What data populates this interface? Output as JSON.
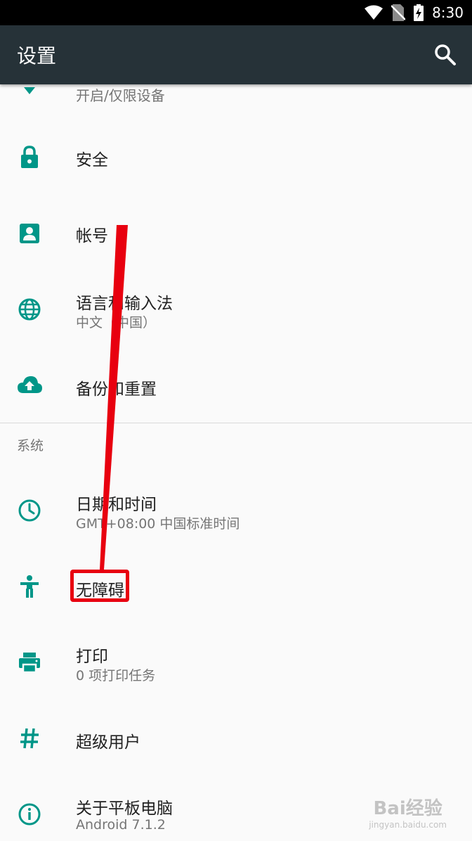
{
  "status_bar": {
    "time": "8:30",
    "icons": [
      "wifi-icon",
      "no-sim-icon",
      "battery-charging-icon"
    ]
  },
  "app_bar": {
    "title": "设置",
    "search_icon": "search-icon"
  },
  "colors": {
    "accent": "#009688",
    "app_bar": "#263238",
    "annotation_red": "#e8000f"
  },
  "list": {
    "partial_item": {
      "subtitle": "开启/仅限设备",
      "icon": "location-icon"
    },
    "items": [
      {
        "title": "安全",
        "icon": "lock-icon"
      },
      {
        "title": "帐号",
        "icon": "account-icon"
      },
      {
        "title": "语言和输入法",
        "subtitle": "中文（中国）",
        "icon": "globe-icon"
      },
      {
        "title": "备份和重置",
        "icon": "cloud-upload-icon"
      }
    ],
    "section_header": "系统",
    "system_items": [
      {
        "title": "日期和时间",
        "subtitle": "GMT+08:00 中国标准时间",
        "icon": "clock-icon"
      },
      {
        "title": "无障碍",
        "icon": "accessibility-icon"
      },
      {
        "title": "打印",
        "subtitle": "0 项打印任务",
        "icon": "print-icon"
      },
      {
        "title": "超级用户",
        "icon": "hash-icon"
      },
      {
        "title": "关于平板电脑",
        "subtitle": "Android 7.1.2",
        "icon": "info-icon"
      }
    ]
  },
  "watermark": {
    "main": "Bai经验",
    "sub": "jingyan.baidu.com"
  }
}
